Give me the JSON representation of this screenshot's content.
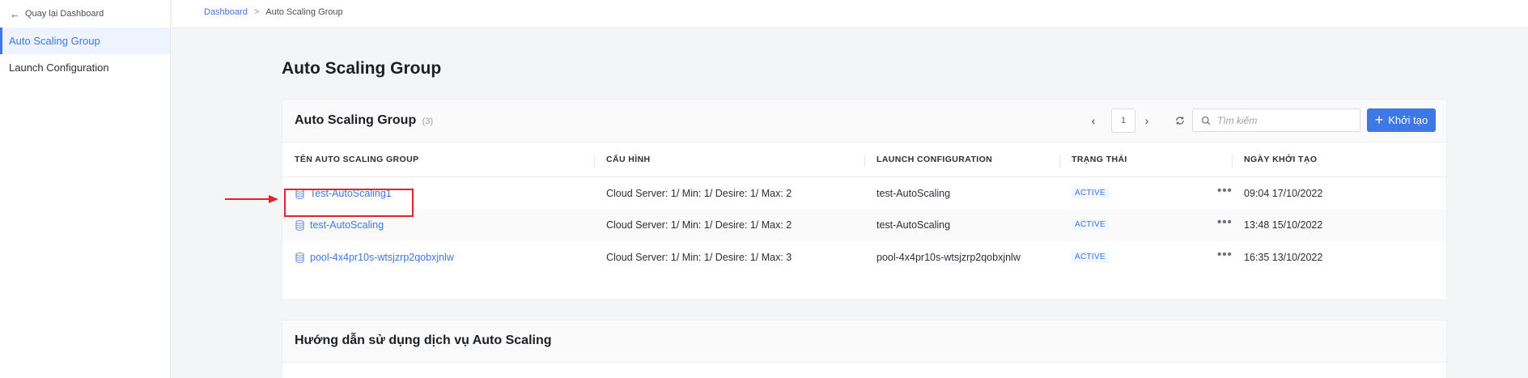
{
  "sidebar": {
    "back_label": "Quay lại Dashboard",
    "items": [
      {
        "label": "Auto Scaling Group",
        "active": true
      },
      {
        "label": "Launch Configuration",
        "active": false
      }
    ]
  },
  "breadcrumb": {
    "root": "Dashboard",
    "separator": ">",
    "current": "Auto Scaling Group"
  },
  "page_title": "Auto Scaling Group",
  "card": {
    "title": "Auto Scaling Group",
    "count": "(3)",
    "page_number": "1",
    "search_placeholder": "Tìm kiếm",
    "create_label": "Khởi tạo"
  },
  "table": {
    "headers": [
      "TÊN AUTO SCALING GROUP",
      "CẤU HÌNH",
      "LAUNCH CONFIGURATION",
      "TRẠNG THÁI",
      "NGÀY KHỞI TẠO"
    ],
    "rows": [
      {
        "name": "Test-AutoScaling1",
        "config": "Cloud Server: 1/ Min: 1/ Desire: 1/ Max: 2",
        "launch_config": "test-AutoScaling",
        "status": "ACTIVE",
        "created": "09:04 17/10/2022"
      },
      {
        "name": "test-AutoScaling",
        "config": "Cloud Server: 1/ Min: 1/ Desire: 1/ Max: 2",
        "launch_config": "test-AutoScaling",
        "status": "ACTIVE",
        "created": "13:48 15/10/2022"
      },
      {
        "name": "pool-4x4pr10s-wtsjzrp2qobxjnlw",
        "config": "Cloud Server: 1/ Min: 1/ Desire: 1/ Max: 3",
        "launch_config": "pool-4x4pr10s-wtsjzrp2qobxjnlw",
        "status": "ACTIVE",
        "created": "16:35 13/10/2022"
      }
    ],
    "more_label": "•••"
  },
  "guide": {
    "title": "Hướng dẫn sử dụng dịch vụ Auto Scaling"
  },
  "colors": {
    "accent": "#3d78e6",
    "highlight": "#e6212b"
  }
}
